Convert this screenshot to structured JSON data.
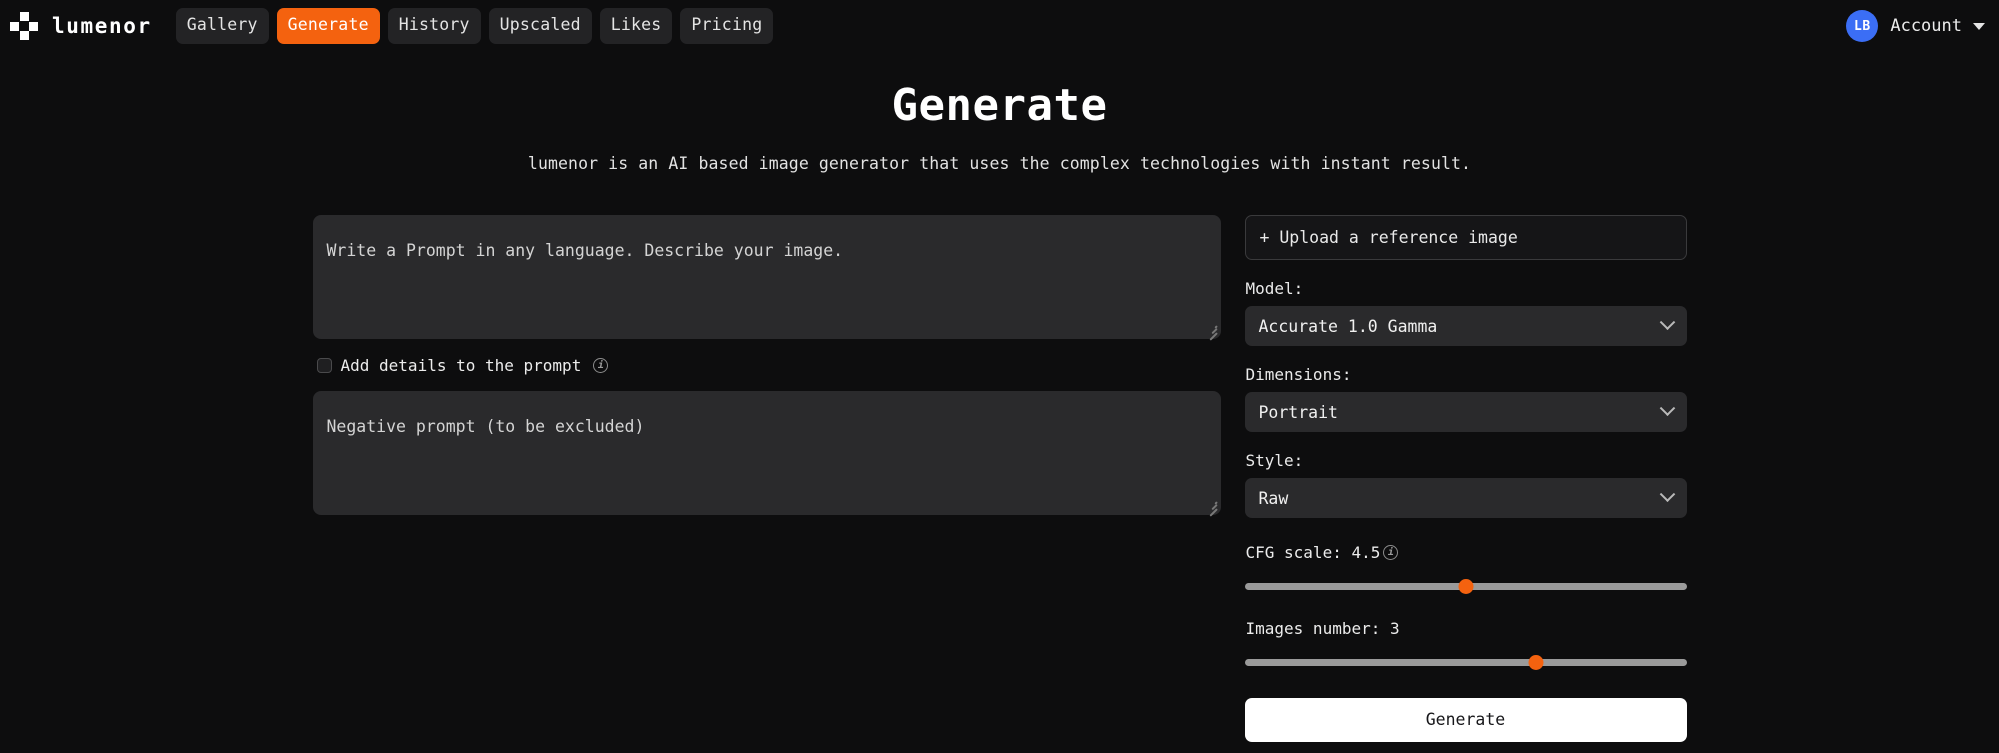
{
  "header": {
    "brand": "lumenor",
    "nav": [
      {
        "label": "Gallery",
        "active": false
      },
      {
        "label": "Generate",
        "active": true
      },
      {
        "label": "History",
        "active": false
      },
      {
        "label": "Upscaled",
        "active": false
      },
      {
        "label": "Likes",
        "active": false
      },
      {
        "label": "Pricing",
        "active": false
      }
    ],
    "avatar_initials": "LB",
    "account_label": "Account"
  },
  "hero": {
    "title": "Generate",
    "subtitle": "lumenor is an AI based image generator that uses the complex technologies with instant result."
  },
  "form": {
    "prompt_placeholder": "Write a Prompt in any language. Describe your image.",
    "prompt_value": "",
    "add_details_label": "Add details to the prompt",
    "add_details_checked": false,
    "add_details_info": "i",
    "negative_placeholder": "Negative prompt (to be excluded)",
    "negative_value": ""
  },
  "panel": {
    "upload_label": "+ Upload a reference image",
    "model_label": "Model:",
    "model_value": "Accurate 1.0 Gamma",
    "dimensions_label": "Dimensions:",
    "dimensions_value": "Portrait",
    "style_label": "Style:",
    "style_value": "Raw",
    "cfg_label": "CFG scale: 4.5",
    "cfg_info": "i",
    "cfg_percent": 50,
    "images_label": "Images number: 3",
    "images_percent": 66,
    "generate_label": "Generate"
  },
  "colors": {
    "accent": "#f4620f",
    "background": "#0d0d0e",
    "surface": "#2a2a2c",
    "avatar": "#3b6ef5"
  }
}
